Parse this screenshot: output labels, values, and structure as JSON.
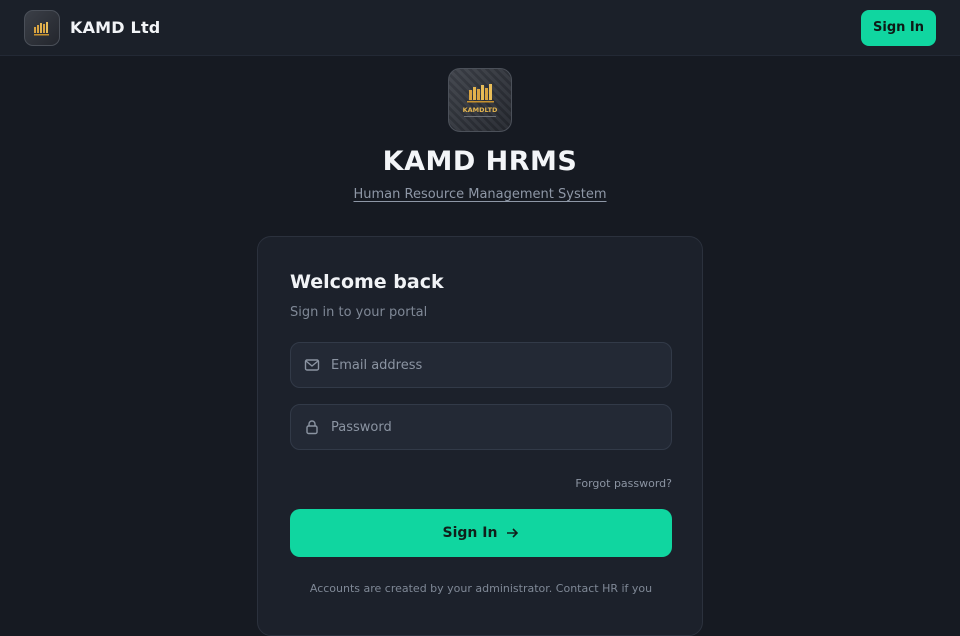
{
  "header": {
    "brand_name": "KAMD Ltd",
    "signin_label": "Sign In"
  },
  "hero": {
    "logo_text": "KAMDLTD",
    "title": "KAMD HRMS",
    "subtitle": "Human Resource Management System"
  },
  "login": {
    "title": "Welcome back",
    "subtitle": "Sign in to your portal",
    "email": {
      "placeholder": "Email address",
      "value": ""
    },
    "password": {
      "placeholder": "Password",
      "value": ""
    },
    "forgot_label": "Forgot password?",
    "submit_label": "Sign In",
    "note": "Accounts are created by your administrator. Contact HR if you"
  },
  "icons": {
    "email": "mail-icon",
    "password": "lock-icon",
    "submit": "arrow-right-icon"
  },
  "colors": {
    "accent": "#10d6a0",
    "background": "#161a22",
    "card": "#1c212b"
  }
}
